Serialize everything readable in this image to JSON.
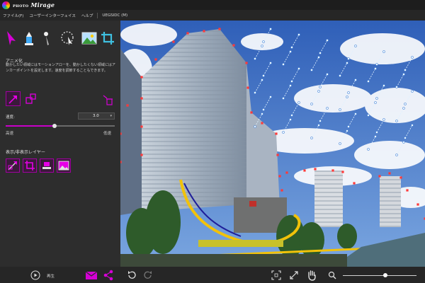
{
  "app": {
    "logo_small": "PHOTO",
    "logo_big": "Mirage"
  },
  "menu": {
    "items": [
      "ファイル(F)",
      "ユーザーインターフェイス",
      "ヘルプ",
      "UEGSIDC (M)"
    ]
  },
  "tools": {
    "animate": "arrow-tool-icon",
    "anchor": "anchor-tool-icon",
    "select": "select-tool-icon",
    "lasso": "lasso-tool-icon",
    "image": "image-tool-icon",
    "crop": "crop-tool-icon"
  },
  "panel": {
    "section_title": "アニメ化",
    "description": "動かしたい領域にはモーションアローを、動かしたくない領域にはアンカーポイントを設定します。速度を調節することもできます。",
    "speed_label": "速度:",
    "speed_value": "3.0",
    "speed_fraction": 0.45,
    "slow_label": "高速",
    "fast_label": "低速",
    "layers_title": "表示/非表示レイヤー"
  },
  "bottom": {
    "play_label": "再生",
    "zoom_fraction": 0.58
  },
  "colors": {
    "accent": "#c800c8",
    "sky": "#3f6fc2",
    "panel": "#2d2d2d"
  }
}
